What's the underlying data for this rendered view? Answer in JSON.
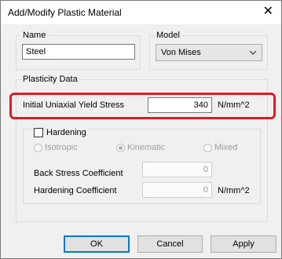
{
  "window": {
    "title": "Add/Modify Plastic Material",
    "close_glyph": "✕"
  },
  "name_group": {
    "legend": "Name",
    "value": "Steel"
  },
  "model_group": {
    "legend": "Model",
    "selected": "Von Mises"
  },
  "plasticity": {
    "legend": "Plasticity Data",
    "yield_label": "Initial Uniaxial Yield Stress",
    "yield_value": "340",
    "yield_unit": "N/mm^2"
  },
  "hardening": {
    "checkbox_label": "Hardening",
    "checked": false,
    "options": [
      "Isotropic",
      "Kinematic",
      "Mixed"
    ],
    "selected_option": "Kinematic",
    "back_stress_label": "Back Stress Coefficient",
    "back_stress_value": "0",
    "coef_label": "Hardening Coefficient",
    "coef_value": "0",
    "coef_unit": "N/mm^2"
  },
  "buttons": {
    "ok": "OK",
    "cancel": "Cancel",
    "apply": "Apply"
  },
  "colors": {
    "highlight": "#e01b22",
    "default_button_border": "#0078d7",
    "dialog_bg": "#f0f0f0"
  },
  "icons": {
    "close": "close-icon",
    "dropdown": "chevron-down-icon"
  }
}
